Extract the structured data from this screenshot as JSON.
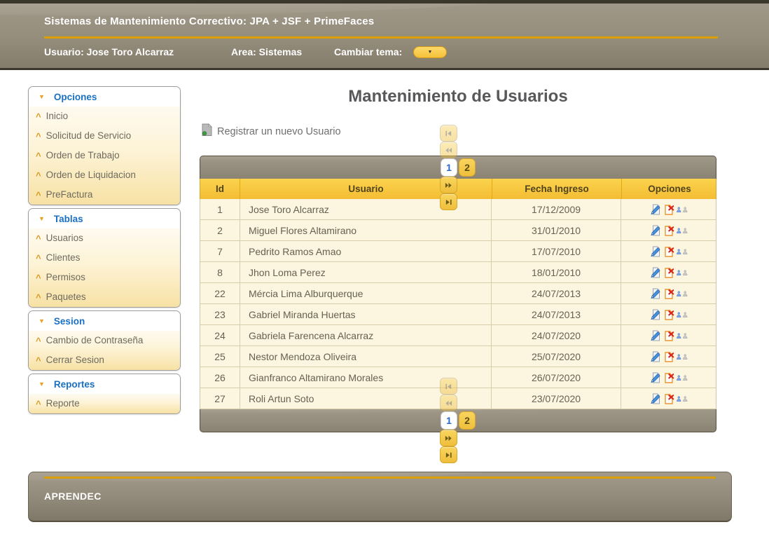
{
  "header": {
    "title": "Sistemas de Mantenimiento Correctivo: JPA + JSF + PrimeFaces",
    "user_label": "Usuario: Jose Toro Alcarraz",
    "area_label": "Area: Sistemas",
    "theme_label": "Cambiar tema:"
  },
  "sidebar": {
    "sections": [
      {
        "label": "Opciones",
        "items": [
          "Inicio",
          "Solicitud de Servicio",
          "Orden de Trabajo",
          "Orden de Liquidacion",
          "PreFactura"
        ]
      },
      {
        "label": "Tablas",
        "items": [
          "Usuarios",
          "Clientes",
          "Permisos",
          "Paquetes"
        ]
      },
      {
        "label": "Sesion",
        "items": [
          "Cambio de Contraseña",
          "Cerrar Sesion"
        ]
      },
      {
        "label": "Reportes",
        "items": [
          "Reporte"
        ]
      }
    ]
  },
  "main": {
    "page_title": "Mantenimiento de Usuarios",
    "register_link": "Registrar un nuevo Usuario",
    "table": {
      "columns": [
        "Id",
        "Usuario",
        "Fecha Ingreso",
        "Opciones"
      ],
      "rows": [
        {
          "id": "1",
          "usuario": "Jose Toro Alcarraz",
          "fecha": "17/12/2009",
          "person_active": true
        },
        {
          "id": "2",
          "usuario": "Miguel Flores Altamirano",
          "fecha": "31/01/2010",
          "person_active": true
        },
        {
          "id": "7",
          "usuario": "Pedrito Ramos Amao",
          "fecha": "17/07/2010",
          "person_active": false
        },
        {
          "id": "8",
          "usuario": "Jhon Loma Perez",
          "fecha": "18/01/2010",
          "person_active": false
        },
        {
          "id": "22",
          "usuario": "Mércia Lima Alburquerque",
          "fecha": "24/07/2013",
          "person_active": true
        },
        {
          "id": "23",
          "usuario": "Gabriel Miranda Huertas",
          "fecha": "24/07/2013",
          "person_active": true
        },
        {
          "id": "24",
          "usuario": "Gabriela Farencena Alcarraz",
          "fecha": "24/07/2020",
          "person_active": false
        },
        {
          "id": "25",
          "usuario": "Nestor Mendoza Oliveira",
          "fecha": "25/07/2020",
          "person_active": true
        },
        {
          "id": "26",
          "usuario": "Gianfranco Altamirano Morales",
          "fecha": "26/07/2020",
          "person_active": true
        },
        {
          "id": "27",
          "usuario": "Roli Artun Soto",
          "fecha": "23/07/2020",
          "person_active": true
        }
      ],
      "paginator": {
        "pages": [
          "1",
          "2"
        ],
        "active_page": "1",
        "first_enabled": false,
        "prev_enabled": false,
        "next_enabled": true,
        "last_enabled": true
      }
    }
  },
  "footer": {
    "brand": "APRENDEC"
  },
  "icons": {
    "register": "new-document-icon",
    "edit": "edit-document-icon",
    "delete": "delete-document-icon",
    "person": "person-icon",
    "section_header": "triangle-down-icon",
    "item_bullet": "chevron-up-icon",
    "theme_dropdown": "chevron-down-icon"
  },
  "colors": {
    "accent_gold": "#dd9f00",
    "header_band": "#948c7b",
    "section_title_blue": "#1a70c2",
    "table_header_gold": "#f6c73f",
    "row_cream": "#fcf5e0",
    "active_page_blue": "#2967c9",
    "person_active_blue": "#7da7e8",
    "person_inactive_gray": "#c4c4c4"
  }
}
